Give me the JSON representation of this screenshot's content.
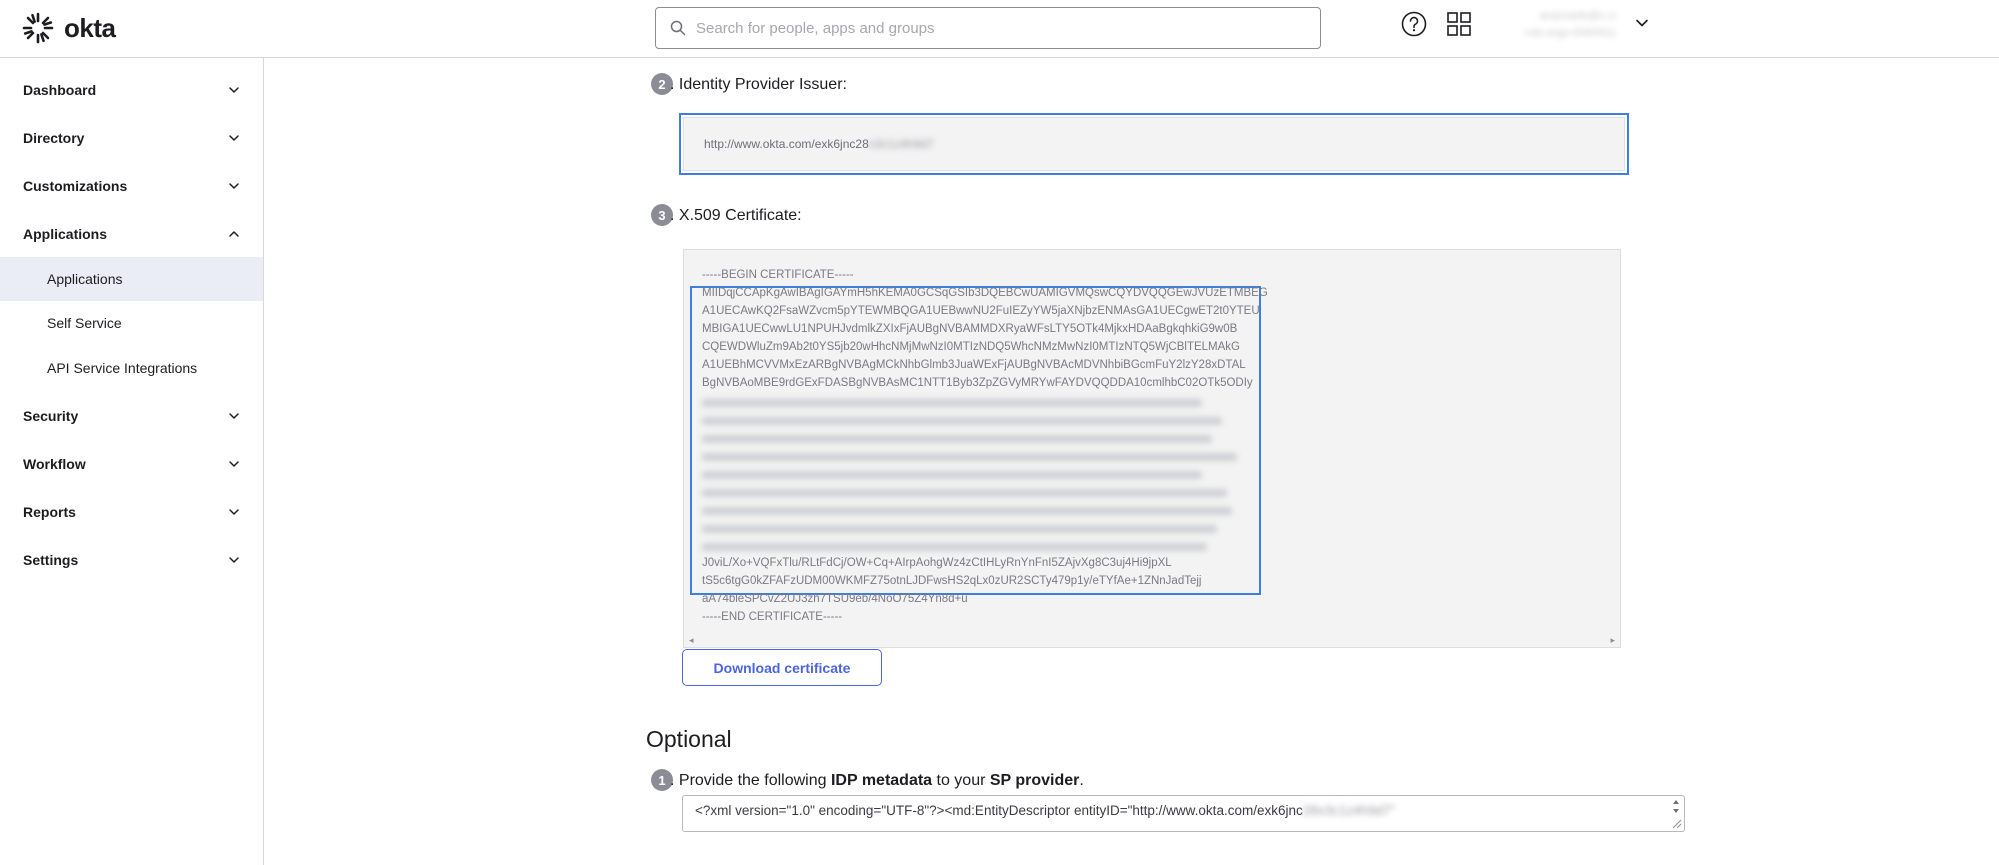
{
  "header": {
    "logo_text": "okta",
    "search_placeholder": "Search for people, apps and groups",
    "user_line1": "anarosefe@c.ci",
    "user_line2": "ruls-sogn-8484911",
    "icons": [
      "okta-logo-icon",
      "search-icon",
      "help-icon",
      "app-grid-icon",
      "chevron-down-icon"
    ]
  },
  "sidebar": {
    "items": [
      {
        "label": "Dashboard",
        "expanded": false
      },
      {
        "label": "Directory",
        "expanded": false
      },
      {
        "label": "Customizations",
        "expanded": false
      },
      {
        "label": "Applications",
        "expanded": true
      },
      {
        "label": "Security",
        "expanded": false
      },
      {
        "label": "Workflow",
        "expanded": false
      },
      {
        "label": "Reports",
        "expanded": false
      },
      {
        "label": "Settings",
        "expanded": false
      }
    ],
    "sub_items": [
      {
        "label": "Applications",
        "active": true
      },
      {
        "label": "Self Service",
        "active": false
      },
      {
        "label": "API Service Integrations",
        "active": false
      }
    ]
  },
  "main": {
    "step2": {
      "number": "2",
      "label": ". Identity Provider Issuer:"
    },
    "issuer_value": "http://www.okta.com/exk6jnc28",
    "issuer_value_hidden": "x3c1z4h9d7",
    "step3": {
      "number": "3",
      "label": ". X.509 Certificate:"
    },
    "cert": {
      "begin": "-----BEGIN CERTIFICATE-----",
      "lines": [
        "MIIDqjCCApKgAwIBAgIGAYmH5hKEMA0GCSqGSIb3DQEBCwUAMIGVMQswCQYDVQQGEwJVUzETMBEG",
        "A1UECAwKQ2FsaWZvcm5pYTEWMBQGA1UEBwwNU2FuIEZyYW5jaXNjbzENMAsGA1UECgwET2t0YTEU",
        "MBIGA1UECwwLU1NPUHJvdmlkZXIxFjAUBgNVBAMMDXRyaWFsLTY5OTk4MjkxHDAaBgkqhkiG9w0B",
        "CQEWDWluZm9Ab2t0YS5jb20wHhcNMjMwNzI0MTIzNDQ5WhcNMzMwNzI0MTIzNTQ5WjCBlTELMAkG",
        "A1UEBhMCVVMxEzARBgNVBAgMCkNhbGlmb3JuaWExFjAUBgNVBAcMDVNhbiBGcmFuY2lzY28xDTAL",
        "BgNVBAoMBE9rdGExFDASBgNVBAsMC1NTT1Byb3ZpZGVyMRYwFAYDVQQDDA10cmlhbC02OTk5ODIy"
      ],
      "tail_lines": [
        "J0viL/Xo+VQFxTlu/RLtFdCj/OW+Cq+AIrpAohgWz4zCtIHLyRnYnFnI5ZAjvXg8C3uj4Hi9jpXL",
        "tS5c6tgG0kZFAFzUDM00WKMFZ75otnLJDFwsHS2qLx0zUR2SCTy479p1y/eTYfAe+1ZNnJadTejj",
        "aA74bleSPCvZ2UJ3zh7TSU9eb/4NoO75Z4Yn8d+u"
      ],
      "end": "-----END CERTIFICATE-----"
    },
    "download_button": "Download certificate",
    "optional_title": "Optional",
    "step1": {
      "number": "1",
      "prefix": ". Provide the following ",
      "bold1": "IDP metadata",
      "middle": " to your ",
      "bold2": "SP provider",
      "suffix": "."
    },
    "metadata_value": "<?xml version=\"1.0\" encoding=\"UTF-8\"?><md:EntityDescriptor entityID=\"http://www.okta.com/exk6jnc",
    "metadata_hidden": "28x3c1z4h9d7\""
  },
  "colors": {
    "accent": "#4c64e1",
    "focus": "#3d7fe0",
    "active_bg": "#ebedf6"
  }
}
